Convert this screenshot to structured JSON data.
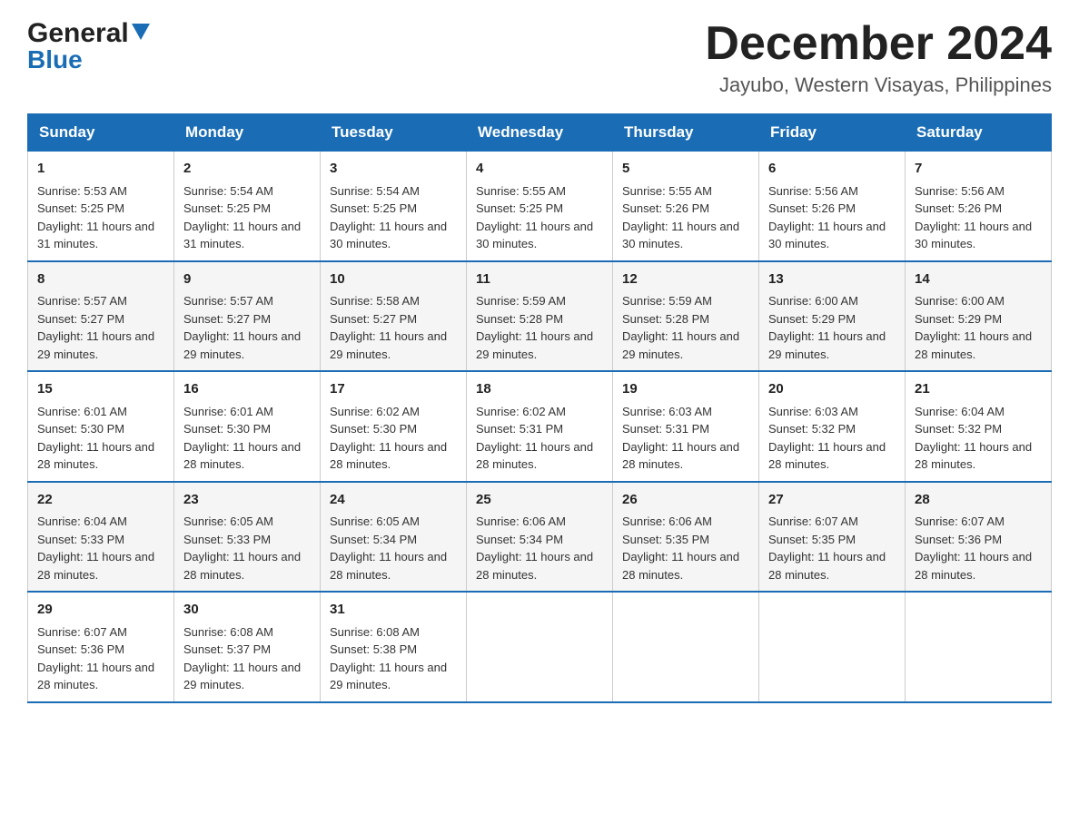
{
  "header": {
    "logo_general": "General",
    "logo_blue": "Blue",
    "month_title": "December 2024",
    "location": "Jayubo, Western Visayas, Philippines"
  },
  "weekdays": [
    "Sunday",
    "Monday",
    "Tuesday",
    "Wednesday",
    "Thursday",
    "Friday",
    "Saturday"
  ],
  "weeks": [
    [
      {
        "day": "1",
        "sunrise": "5:53 AM",
        "sunset": "5:25 PM",
        "daylight": "11 hours and 31 minutes."
      },
      {
        "day": "2",
        "sunrise": "5:54 AM",
        "sunset": "5:25 PM",
        "daylight": "11 hours and 31 minutes."
      },
      {
        "day": "3",
        "sunrise": "5:54 AM",
        "sunset": "5:25 PM",
        "daylight": "11 hours and 30 minutes."
      },
      {
        "day": "4",
        "sunrise": "5:55 AM",
        "sunset": "5:25 PM",
        "daylight": "11 hours and 30 minutes."
      },
      {
        "day": "5",
        "sunrise": "5:55 AM",
        "sunset": "5:26 PM",
        "daylight": "11 hours and 30 minutes."
      },
      {
        "day": "6",
        "sunrise": "5:56 AM",
        "sunset": "5:26 PM",
        "daylight": "11 hours and 30 minutes."
      },
      {
        "day": "7",
        "sunrise": "5:56 AM",
        "sunset": "5:26 PM",
        "daylight": "11 hours and 30 minutes."
      }
    ],
    [
      {
        "day": "8",
        "sunrise": "5:57 AM",
        "sunset": "5:27 PM",
        "daylight": "11 hours and 29 minutes."
      },
      {
        "day": "9",
        "sunrise": "5:57 AM",
        "sunset": "5:27 PM",
        "daylight": "11 hours and 29 minutes."
      },
      {
        "day": "10",
        "sunrise": "5:58 AM",
        "sunset": "5:27 PM",
        "daylight": "11 hours and 29 minutes."
      },
      {
        "day": "11",
        "sunrise": "5:59 AM",
        "sunset": "5:28 PM",
        "daylight": "11 hours and 29 minutes."
      },
      {
        "day": "12",
        "sunrise": "5:59 AM",
        "sunset": "5:28 PM",
        "daylight": "11 hours and 29 minutes."
      },
      {
        "day": "13",
        "sunrise": "6:00 AM",
        "sunset": "5:29 PM",
        "daylight": "11 hours and 29 minutes."
      },
      {
        "day": "14",
        "sunrise": "6:00 AM",
        "sunset": "5:29 PM",
        "daylight": "11 hours and 28 minutes."
      }
    ],
    [
      {
        "day": "15",
        "sunrise": "6:01 AM",
        "sunset": "5:30 PM",
        "daylight": "11 hours and 28 minutes."
      },
      {
        "day": "16",
        "sunrise": "6:01 AM",
        "sunset": "5:30 PM",
        "daylight": "11 hours and 28 minutes."
      },
      {
        "day": "17",
        "sunrise": "6:02 AM",
        "sunset": "5:30 PM",
        "daylight": "11 hours and 28 minutes."
      },
      {
        "day": "18",
        "sunrise": "6:02 AM",
        "sunset": "5:31 PM",
        "daylight": "11 hours and 28 minutes."
      },
      {
        "day": "19",
        "sunrise": "6:03 AM",
        "sunset": "5:31 PM",
        "daylight": "11 hours and 28 minutes."
      },
      {
        "day": "20",
        "sunrise": "6:03 AM",
        "sunset": "5:32 PM",
        "daylight": "11 hours and 28 minutes."
      },
      {
        "day": "21",
        "sunrise": "6:04 AM",
        "sunset": "5:32 PM",
        "daylight": "11 hours and 28 minutes."
      }
    ],
    [
      {
        "day": "22",
        "sunrise": "6:04 AM",
        "sunset": "5:33 PM",
        "daylight": "11 hours and 28 minutes."
      },
      {
        "day": "23",
        "sunrise": "6:05 AM",
        "sunset": "5:33 PM",
        "daylight": "11 hours and 28 minutes."
      },
      {
        "day": "24",
        "sunrise": "6:05 AM",
        "sunset": "5:34 PM",
        "daylight": "11 hours and 28 minutes."
      },
      {
        "day": "25",
        "sunrise": "6:06 AM",
        "sunset": "5:34 PM",
        "daylight": "11 hours and 28 minutes."
      },
      {
        "day": "26",
        "sunrise": "6:06 AM",
        "sunset": "5:35 PM",
        "daylight": "11 hours and 28 minutes."
      },
      {
        "day": "27",
        "sunrise": "6:07 AM",
        "sunset": "5:35 PM",
        "daylight": "11 hours and 28 minutes."
      },
      {
        "day": "28",
        "sunrise": "6:07 AM",
        "sunset": "5:36 PM",
        "daylight": "11 hours and 28 minutes."
      }
    ],
    [
      {
        "day": "29",
        "sunrise": "6:07 AM",
        "sunset": "5:36 PM",
        "daylight": "11 hours and 28 minutes."
      },
      {
        "day": "30",
        "sunrise": "6:08 AM",
        "sunset": "5:37 PM",
        "daylight": "11 hours and 29 minutes."
      },
      {
        "day": "31",
        "sunrise": "6:08 AM",
        "sunset": "5:38 PM",
        "daylight": "11 hours and 29 minutes."
      },
      null,
      null,
      null,
      null
    ]
  ]
}
